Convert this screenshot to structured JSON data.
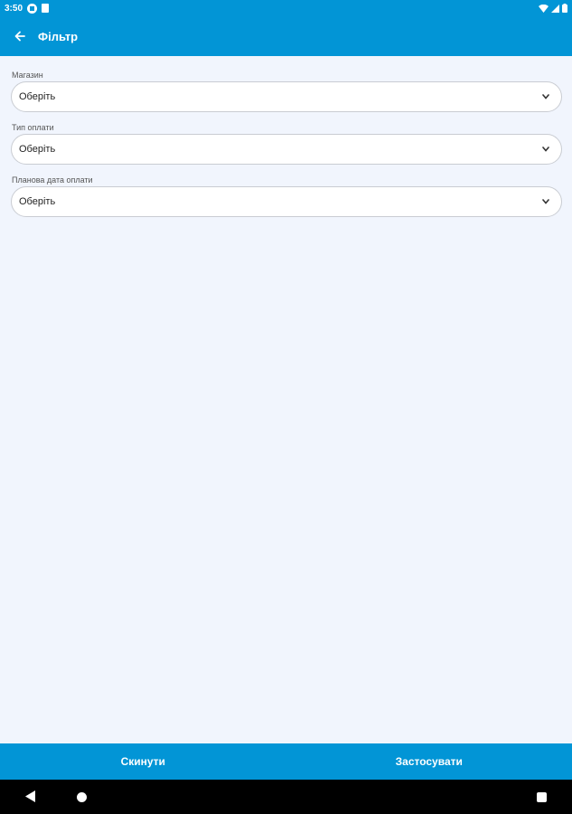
{
  "status_bar": {
    "time": "3:50"
  },
  "app_bar": {
    "title": "Фільтр"
  },
  "fields": [
    {
      "label": "Магазин",
      "value": "Оберіть"
    },
    {
      "label": "Тип оплати",
      "value": "Оберіть"
    },
    {
      "label": "Планова дата оплати",
      "value": "Оберіть"
    }
  ],
  "actions": {
    "reset_label": "Скинути",
    "apply_label": "Застосувати"
  },
  "colors": {
    "primary": "#0295d6",
    "background": "#f1f5fd"
  },
  "icons": {
    "back": "arrow-left-icon",
    "dropdown": "chevron-down-icon"
  }
}
